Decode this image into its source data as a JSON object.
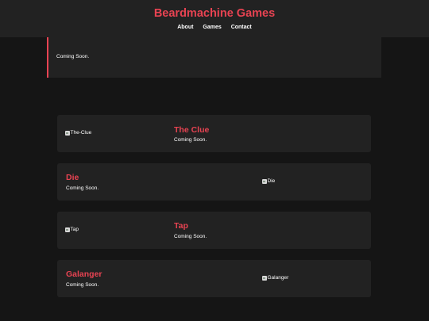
{
  "header": {
    "title": "Beardmachine Games",
    "nav": [
      "About",
      "Games",
      "Contact"
    ]
  },
  "intro": {
    "text": "Coming Soon."
  },
  "games": [
    {
      "title": "The Clue",
      "desc": "Coming Soon.",
      "img_alt": "The-Clue"
    },
    {
      "title": "Die",
      "desc": "Coming Soon.",
      "img_alt": "Die"
    },
    {
      "title": "Tap",
      "desc": "Coming Soon.",
      "img_alt": "Tap"
    },
    {
      "title": "Galanger",
      "desc": "Coming Soon.",
      "img_alt": "Galanger"
    }
  ],
  "colors": {
    "accent": "#e84352",
    "background": "#151515",
    "panel": "#222222"
  },
  "icons": [
    "broken-image-icon"
  ]
}
